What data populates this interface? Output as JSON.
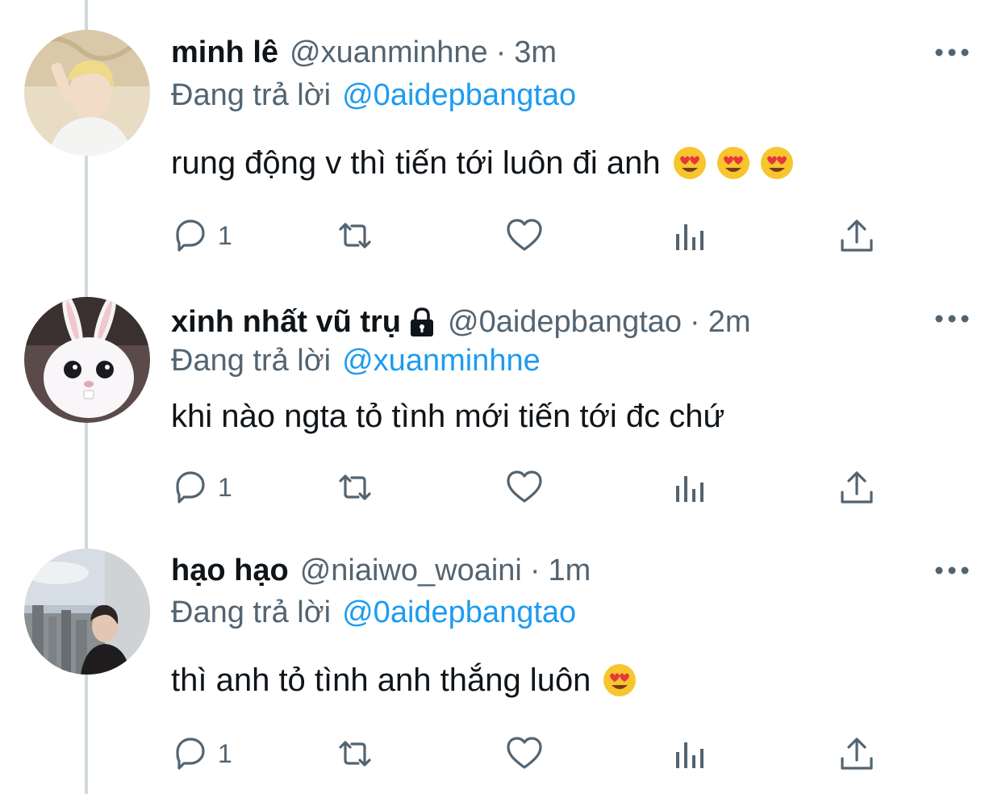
{
  "tweets": [
    {
      "name": "minh lê",
      "handle": "@xuanminhne",
      "separator": "·",
      "time": "3m",
      "replying_prefix": "Đang trả lời",
      "replying_to": "@0aidepbangtao",
      "text": "rung động v thì tiến tới luôn đi anh",
      "emojis": [
        "heart-eyes-emoji",
        "heart-eyes-emoji",
        "heart-eyes-emoji"
      ],
      "reply_count": "1",
      "locked": false,
      "avatar": "avatar-blond-person"
    },
    {
      "name": "xinh nhất vũ trụ",
      "handle": "@0aidepbangtao",
      "separator": "·",
      "time": "2m",
      "replying_prefix": "Đang trả lời",
      "replying_to": "@xuanminhne",
      "text": "khi nào ngta tỏ tình mới tiến tới đc chứ",
      "emojis": [],
      "reply_count": "1",
      "locked": true,
      "avatar": "avatar-white-bunny"
    },
    {
      "name": "hạo hạo",
      "handle": "@niaiwo_woaini",
      "separator": "·",
      "time": "1m",
      "replying_prefix": "Đang trả lời",
      "replying_to": "@0aidepbangtao",
      "text": "thì anh tỏ tình anh thắng luôn",
      "emojis": [
        "heart-eyes-emoji"
      ],
      "reply_count": "1",
      "locked": false,
      "avatar": "avatar-city-person"
    }
  ],
  "icons": {
    "reply": "reply-icon",
    "retweet": "retweet-icon",
    "like": "heart-icon",
    "views": "analytics-icon",
    "share": "share-icon",
    "more": "more-icon",
    "lock": "lock-icon"
  },
  "colors": {
    "text": "#0f1419",
    "secondary": "#536471",
    "link": "#1d9bf0",
    "thread_line": "#cfd9de"
  }
}
